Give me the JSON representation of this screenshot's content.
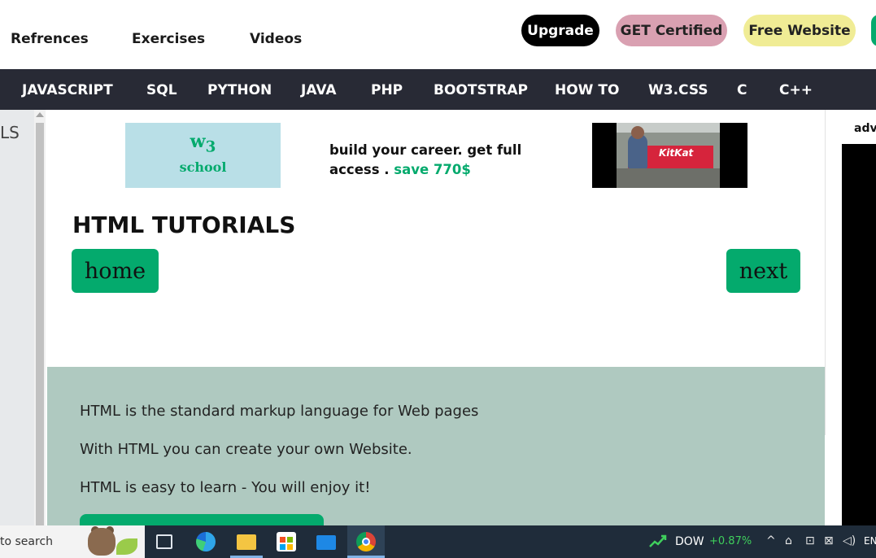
{
  "topnav": {
    "links": [
      "Refrences",
      "Exercises",
      "Videos"
    ],
    "buttons": {
      "upgrade": "Upgrade",
      "certified": "GET Certified",
      "free_website": "Free Website"
    }
  },
  "navbar": {
    "items": [
      "JAVASCRIPT",
      "SQL",
      "PYTHON",
      "JAVA",
      "PHP",
      "BOOTSTRAP",
      "HOW TO",
      "W3.CSS",
      "C",
      "C++"
    ]
  },
  "sidebar": {
    "partial_text": "LS"
  },
  "ad": {
    "logo_w3": "w",
    "logo_sub": "3",
    "logo_school": "school",
    "text": "build your career. get full access . ",
    "save": "save 770$",
    "photo_brand": "KitKat"
  },
  "main": {
    "title": "HTML TUTORIALS",
    "home_button": "home",
    "next_button": "next",
    "intro_lines": [
      "HTML is the standard markup language for Web pages",
      "With HTML you can create your own Website.",
      "HTML is easy to learn - You will enjoy it!"
    ]
  },
  "right_panel": {
    "label": "adv"
  },
  "taskbar": {
    "search_text": "to search",
    "stock_name": "DOW",
    "stock_change": "+0.87%",
    "language": "EN",
    "tray_symbols": [
      "^",
      "⌂",
      "⊡",
      "⊠",
      "◁)"
    ]
  },
  "colors": {
    "accent": "#04aa6d",
    "navbar": "#282a35",
    "intro_bg": "#afc9c0"
  }
}
